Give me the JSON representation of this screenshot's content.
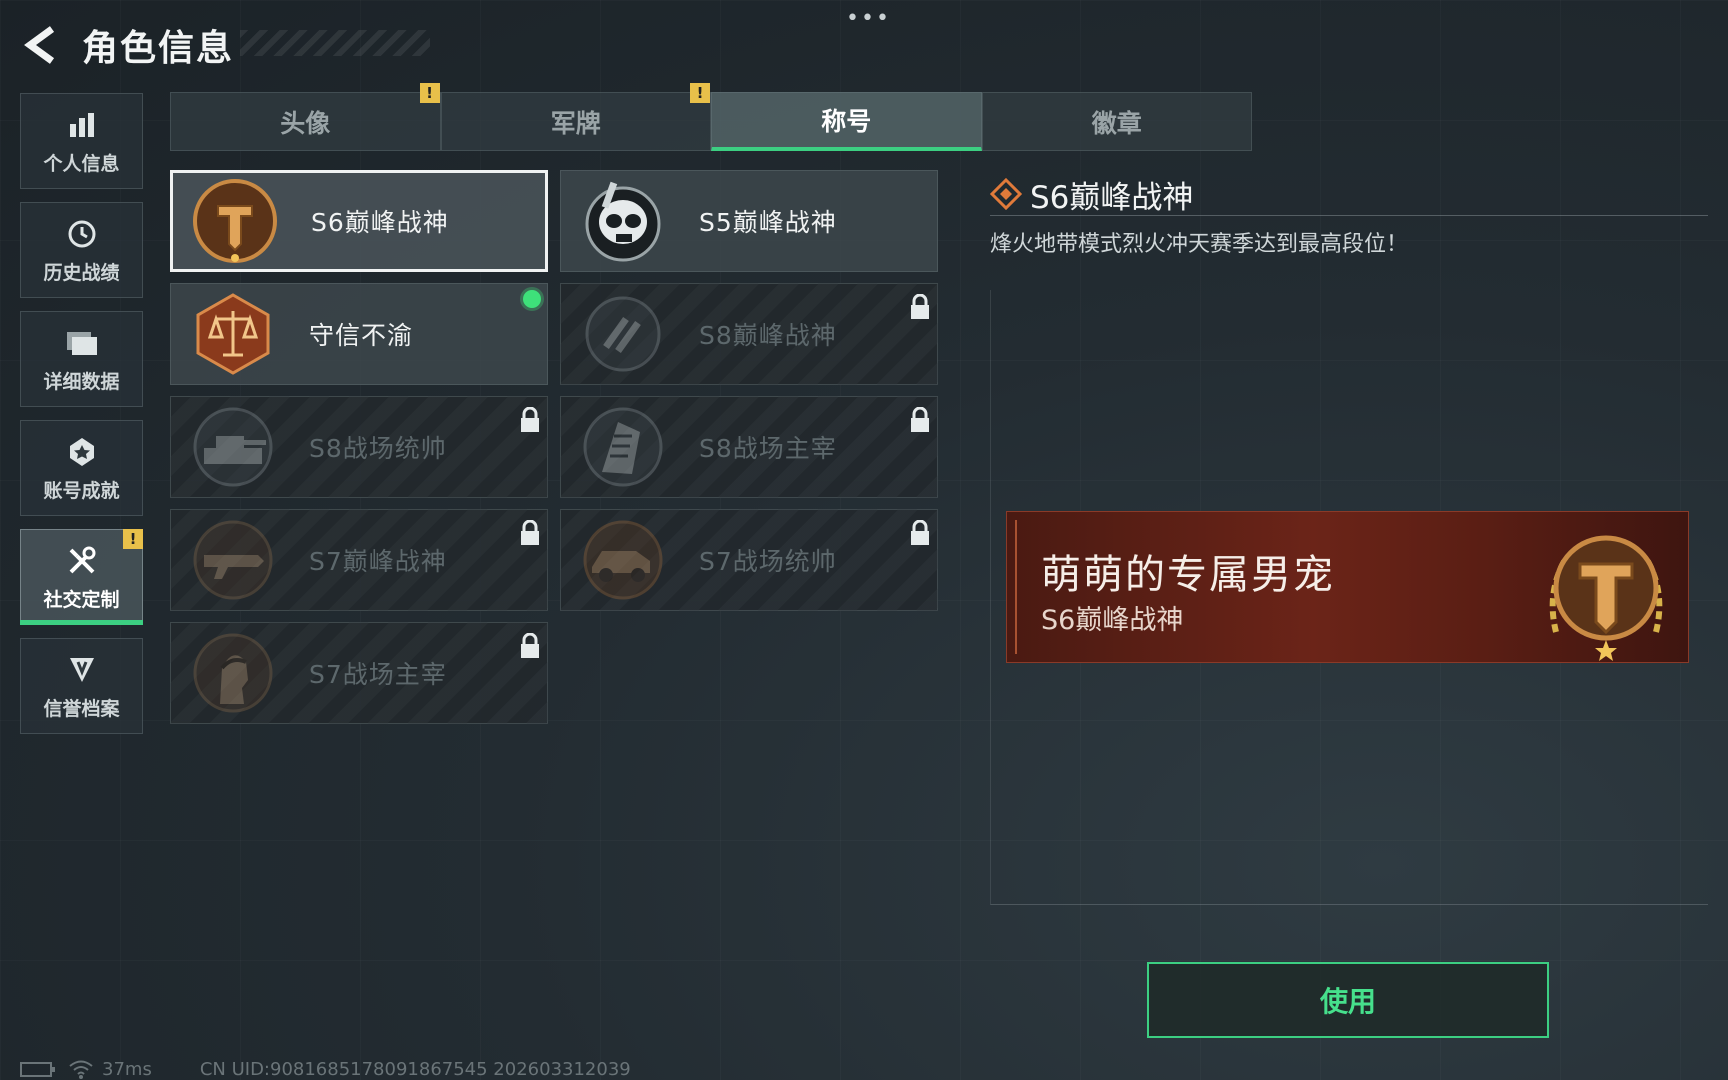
{
  "header": {
    "title": "角色信息",
    "more": "•••"
  },
  "sidebar": {
    "items": [
      {
        "label": "个人信息",
        "icon": "bar-chart-icon"
      },
      {
        "label": "历史战绩",
        "icon": "clock-icon"
      },
      {
        "label": "详细数据",
        "icon": "folder-icon"
      },
      {
        "label": "账号成就",
        "icon": "achievement-icon"
      },
      {
        "label": "社交定制",
        "icon": "tools-icon",
        "active": true,
        "badge": "!"
      },
      {
        "label": "信誉档案",
        "icon": "shield-icon"
      }
    ]
  },
  "tabs": [
    {
      "label": "头像",
      "badge": "!"
    },
    {
      "label": "军牌",
      "badge": "!"
    },
    {
      "label": "称号",
      "active": true
    },
    {
      "label": "徽章"
    }
  ],
  "titles": [
    {
      "name": "S6巅峰战神",
      "state": "selected"
    },
    {
      "name": "S5巅峰战神",
      "state": "unlocked"
    },
    {
      "name": "守信不渝",
      "state": "equipped"
    },
    {
      "name": "S8巅峰战神",
      "state": "locked"
    },
    {
      "name": "S8战场统帅",
      "state": "locked"
    },
    {
      "name": "S8战场主宰",
      "state": "locked"
    },
    {
      "name": "S7巅峰战神",
      "state": "locked"
    },
    {
      "name": "S7战场统帅",
      "state": "locked"
    },
    {
      "name": "S7战场主宰",
      "state": "locked"
    }
  ],
  "detail": {
    "title": "S6巅峰战神",
    "description": "烽火地带模式烈火冲天赛季达到最高段位！"
  },
  "preview": {
    "player_name": "萌萌的专属男宠",
    "title": "S6巅峰战神"
  },
  "actions": {
    "use_label": "使用"
  },
  "footer": {
    "ping": "37ms",
    "uid": "CN UID:9081685178091867545 202603312039"
  },
  "colors": {
    "accent": "#3ccf82",
    "warning": "#e8c04a",
    "banner": "#6b2418"
  }
}
